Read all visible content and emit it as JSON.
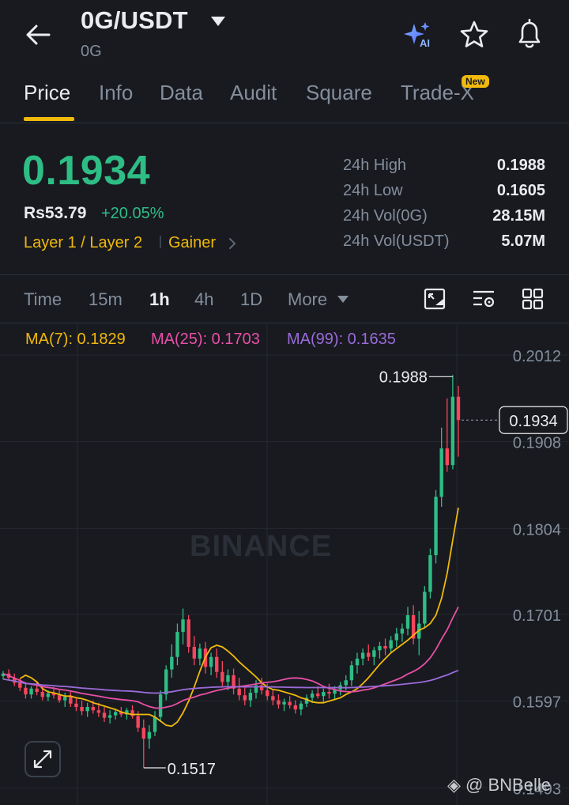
{
  "header": {
    "pair": "0G/USDT",
    "sub": "0G",
    "ai_label": "AI"
  },
  "tabs": [
    {
      "label": "Price",
      "active": true
    },
    {
      "label": "Info"
    },
    {
      "label": "Data"
    },
    {
      "label": "Audit"
    },
    {
      "label": "Square"
    },
    {
      "label": "Trade-X",
      "badge": "New"
    }
  ],
  "ticker": {
    "last_price": "0.1934",
    "fiat_price": "Rs53.79",
    "change": "+20.05%",
    "tag_primary": "Layer 1 / Layer 2",
    "tag_secondary": "Gainer",
    "stats": [
      {
        "label": "24h High",
        "value": "0.1988"
      },
      {
        "label": "24h Low",
        "value": "0.1605"
      },
      {
        "label": "24h Vol(0G)",
        "value": "28.15M"
      },
      {
        "label": "24h Vol(USDT)",
        "value": "5.07M"
      }
    ]
  },
  "intervals": [
    {
      "label": "Time"
    },
    {
      "label": "15m"
    },
    {
      "label": "1h",
      "active": true
    },
    {
      "label": "4h"
    },
    {
      "label": "1D"
    },
    {
      "label": "More"
    }
  ],
  "ma_legend": [
    {
      "label": "MA(7): 0.1829",
      "color": "#f0b90b"
    },
    {
      "label": "MA(25): 0.1703",
      "color": "#e84fa6"
    },
    {
      "label": "MA(99): 0.1635",
      "color": "#9a6bd8"
    }
  ],
  "watermark": "BINANCE",
  "credit": "@ BNBelle",
  "colors": {
    "up": "#2ebd85",
    "down": "#f6465d",
    "accent": "#f0b90b"
  },
  "chart_data": {
    "type": "candlestick",
    "y_ticks": [
      "0.2012",
      "0.1908",
      "0.1804",
      "0.1701",
      "0.1597",
      "0.1493"
    ],
    "ylim": [
      0.148,
      0.203
    ],
    "last_price_label": "0.1934",
    "high_label": "0.1988",
    "low_label": "0.1517",
    "candles": [
      [
        0.1627,
        0.1633,
        0.1623,
        0.163
      ],
      [
        0.163,
        0.1635,
        0.1622,
        0.1625
      ],
      [
        0.1625,
        0.163,
        0.1615,
        0.1619
      ],
      [
        0.1619,
        0.1624,
        0.1609,
        0.1613
      ],
      [
        0.1613,
        0.162,
        0.16,
        0.1605
      ],
      [
        0.1605,
        0.1615,
        0.16,
        0.1612
      ],
      [
        0.1612,
        0.162,
        0.1604,
        0.1608
      ],
      [
        0.1608,
        0.1615,
        0.1598,
        0.1602
      ],
      [
        0.1602,
        0.161,
        0.1597,
        0.1606
      ],
      [
        0.1606,
        0.1614,
        0.16,
        0.1604
      ],
      [
        0.1604,
        0.161,
        0.1595,
        0.1598
      ],
      [
        0.1598,
        0.1607,
        0.159,
        0.1602
      ],
      [
        0.1602,
        0.1608,
        0.159,
        0.1594
      ],
      [
        0.1594,
        0.16,
        0.1585,
        0.159
      ],
      [
        0.159,
        0.1598,
        0.158,
        0.1585
      ],
      [
        0.1585,
        0.1595,
        0.1578,
        0.159
      ],
      [
        0.159,
        0.1598,
        0.1582,
        0.1586
      ],
      [
        0.1586,
        0.1595,
        0.1578,
        0.1583
      ],
      [
        0.1583,
        0.159,
        0.1572,
        0.1577
      ],
      [
        0.1577,
        0.1586,
        0.157,
        0.158
      ],
      [
        0.158,
        0.1588,
        0.1575,
        0.1584
      ],
      [
        0.1584,
        0.159,
        0.1578,
        0.1581
      ],
      [
        0.1581,
        0.1589,
        0.1575,
        0.1586
      ],
      [
        0.1586,
        0.1592,
        0.1576,
        0.1579
      ],
      [
        0.1579,
        0.1585,
        0.156,
        0.1565
      ],
      [
        0.1565,
        0.1575,
        0.1517,
        0.1552
      ],
      [
        0.1552,
        0.1568,
        0.154,
        0.156
      ],
      [
        0.156,
        0.1585,
        0.1555,
        0.1578
      ],
      [
        0.1578,
        0.161,
        0.1572,
        0.1605
      ],
      [
        0.1605,
        0.164,
        0.1598,
        0.1635
      ],
      [
        0.1635,
        0.1665,
        0.1625,
        0.165
      ],
      [
        0.165,
        0.169,
        0.164,
        0.168
      ],
      [
        0.168,
        0.1708,
        0.1665,
        0.1695
      ],
      [
        0.1695,
        0.17,
        0.1655,
        0.1662
      ],
      [
        0.1662,
        0.1675,
        0.164,
        0.1648
      ],
      [
        0.1648,
        0.1666,
        0.164,
        0.166
      ],
      [
        0.166,
        0.1668,
        0.163,
        0.1638
      ],
      [
        0.1638,
        0.1655,
        0.1628,
        0.165
      ],
      [
        0.165,
        0.166,
        0.1625,
        0.1632
      ],
      [
        0.1632,
        0.1645,
        0.1615,
        0.162
      ],
      [
        0.162,
        0.1635,
        0.161,
        0.1628
      ],
      [
        0.1628,
        0.1636,
        0.1605,
        0.1612
      ],
      [
        0.1612,
        0.1625,
        0.1598,
        0.1604
      ],
      [
        0.1604,
        0.1615,
        0.1592,
        0.1598
      ],
      [
        0.1598,
        0.1612,
        0.159,
        0.1607
      ],
      [
        0.1607,
        0.1622,
        0.16,
        0.1616
      ],
      [
        0.1616,
        0.1625,
        0.1605,
        0.161
      ],
      [
        0.161,
        0.1618,
        0.1598,
        0.1603
      ],
      [
        0.1603,
        0.161,
        0.1592,
        0.1598
      ],
      [
        0.1598,
        0.1605,
        0.1588,
        0.1593
      ],
      [
        0.1593,
        0.16,
        0.1585,
        0.1596
      ],
      [
        0.1596,
        0.1603,
        0.1588,
        0.1592
      ],
      [
        0.1592,
        0.1598,
        0.1582,
        0.1587
      ],
      [
        0.1587,
        0.1597,
        0.158,
        0.1594
      ],
      [
        0.1594,
        0.1605,
        0.159,
        0.1601
      ],
      [
        0.1601,
        0.161,
        0.1595,
        0.1606
      ],
      [
        0.1606,
        0.1615,
        0.16,
        0.1603
      ],
      [
        0.1603,
        0.1612,
        0.1596,
        0.1608
      ],
      [
        0.1608,
        0.1618,
        0.16,
        0.1606
      ],
      [
        0.1606,
        0.1615,
        0.1598,
        0.1611
      ],
      [
        0.1611,
        0.162,
        0.1604,
        0.1616
      ],
      [
        0.1616,
        0.1628,
        0.161,
        0.1622
      ],
      [
        0.1622,
        0.1645,
        0.1615,
        0.164
      ],
      [
        0.164,
        0.1655,
        0.163,
        0.1648
      ],
      [
        0.1648,
        0.166,
        0.164,
        0.1655
      ],
      [
        0.1655,
        0.1665,
        0.1645,
        0.165
      ],
      [
        0.165,
        0.1662,
        0.164,
        0.1658
      ],
      [
        0.1658,
        0.1668,
        0.1648,
        0.1663
      ],
      [
        0.1663,
        0.1672,
        0.1652,
        0.166
      ],
      [
        0.166,
        0.1675,
        0.1655,
        0.167
      ],
      [
        0.167,
        0.1685,
        0.1662,
        0.1678
      ],
      [
        0.1678,
        0.169,
        0.1668,
        0.1684
      ],
      [
        0.1684,
        0.171,
        0.1676,
        0.17
      ],
      [
        0.17,
        0.1712,
        0.1665,
        0.1672
      ],
      [
        0.1672,
        0.1705,
        0.1652,
        0.169
      ],
      [
        0.169,
        0.1735,
        0.1685,
        0.1728
      ],
      [
        0.1728,
        0.178,
        0.172,
        0.1772
      ],
      [
        0.1772,
        0.185,
        0.1762,
        0.1842
      ],
      [
        0.1842,
        0.1925,
        0.183,
        0.19
      ],
      [
        0.19,
        0.196,
        0.1872,
        0.188
      ],
      [
        0.188,
        0.1988,
        0.1875,
        0.1962
      ],
      [
        0.1962,
        0.1975,
        0.189,
        0.1934
      ]
    ],
    "ma7": [
      [
        0.1624,
        0.1628,
        0.1625,
        0.162,
        0.1612,
        0.1608,
        0.1607,
        0.1605,
        0.1603,
        0.1603,
        0.1601,
        0.16,
        0.1598,
        0.1595,
        0.1593,
        0.1591,
        0.1589,
        0.1587,
        0.1584,
        0.1582,
        0.1581,
        0.1581,
        0.1581,
        0.1581,
        0.1578,
        0.1573,
        0.1568,
        0.1567,
        0.1572,
        0.1583,
        0.1597,
        0.1614,
        0.1633,
        0.165,
        0.1661,
        0.1664,
        0.1662,
        0.1657,
        0.1651,
        0.1644,
        0.1638,
        0.1632,
        0.1626,
        0.1619,
        0.1614,
        0.1611,
        0.161,
        0.1608,
        0.1606,
        0.1604,
        0.1601,
        0.1599,
        0.1596,
        0.1595,
        0.1595,
        0.1597,
        0.1599,
        0.1601,
        0.1605,
        0.1608,
        0.1612,
        0.1618,
        0.1625,
        0.1633,
        0.1641,
        0.1648,
        0.1655,
        0.166,
        0.1665,
        0.167,
        0.1676,
        0.1682,
        0.1685,
        0.169,
        0.17,
        0.172,
        0.175,
        0.179,
        0.1829
      ]
    ],
    "ma25_desc": "slow average, rising from ~0.1610 to 0.1703",
    "ma99_desc": "slowest average, rising from ~0.1620 to 0.1635"
  }
}
